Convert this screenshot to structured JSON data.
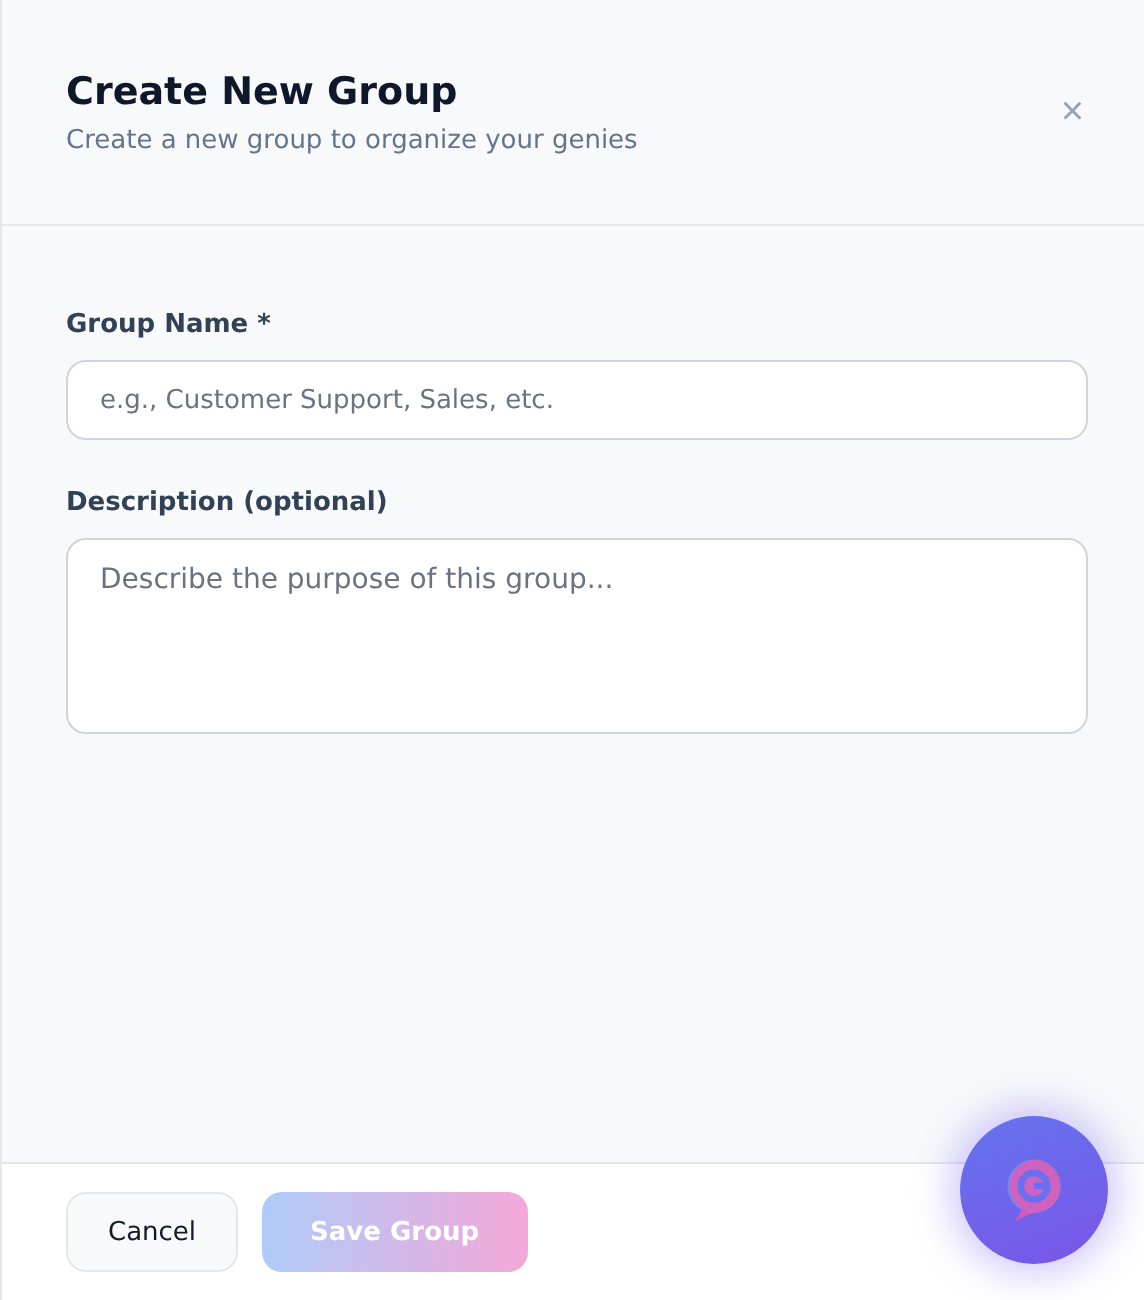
{
  "dialog": {
    "title": "Create New Group",
    "subtitle": "Create a new group to organize your genies",
    "close": "×"
  },
  "fields": [
    {
      "kind": "input",
      "label": "Group Name *",
      "placeholder": "e.g., Customer Support, Sales, etc."
    },
    {
      "kind": "textarea",
      "label": "Description (optional)",
      "placeholder": "Describe the purpose of this group..."
    }
  ],
  "buttons": [
    {
      "label": "Cancel",
      "kind": "secondary",
      "disabled": false
    },
    {
      "label": "Save Group",
      "kind": "primary",
      "disabled": true
    }
  ]
}
